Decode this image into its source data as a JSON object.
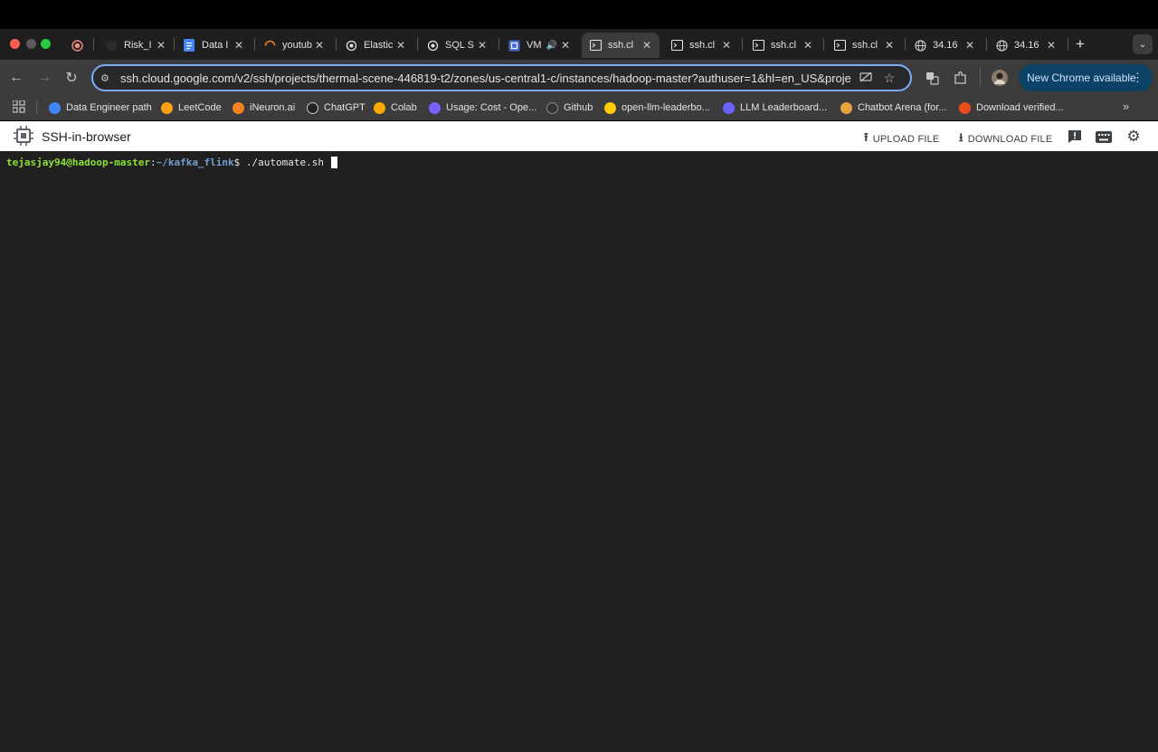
{
  "tabs": [
    {
      "label": "",
      "icon": "record-icon"
    },
    {
      "label": "Risk_I",
      "icon": "github-icon"
    },
    {
      "label": "Data I",
      "icon": "docs-icon"
    },
    {
      "label": "youtub",
      "icon": "loading-icon"
    },
    {
      "label": "Elastic",
      "icon": "openai-icon"
    },
    {
      "label": "SQL S",
      "icon": "openai-icon"
    },
    {
      "label": "VM",
      "icon": "compute-icon",
      "audio": true
    },
    {
      "label": "ssh.cl",
      "icon": "terminal-icon",
      "active": true
    },
    {
      "label": "ssh.cl",
      "icon": "terminal-icon"
    },
    {
      "label": "ssh.cl",
      "icon": "terminal-icon"
    },
    {
      "label": "ssh.cl",
      "icon": "terminal-icon"
    },
    {
      "label": "34.16",
      "icon": "globe-icon"
    },
    {
      "label": "34.16",
      "icon": "globe-icon"
    }
  ],
  "new_tab": "+",
  "address_bar": {
    "url": "ssh.cloud.google.com/v2/ssh/projects/thermal-scene-446819-t2/zones/us-central1-c/instances/hadoop-master?authuser=1&hl=en_US&projec..."
  },
  "update_pill": {
    "label": "New Chrome available",
    "color": "#0b4266"
  },
  "bookmarks": [
    {
      "label": "Data Engineer path",
      "color": "#4285f4"
    },
    {
      "label": "LeetCode",
      "color": "#ffa116"
    },
    {
      "label": "iNeuron.ai",
      "color": "#f6821f"
    },
    {
      "label": "ChatGPT",
      "color": "#222222"
    },
    {
      "label": "Colab",
      "color": "#f9ab00"
    },
    {
      "label": "Usage: Cost - Ope...",
      "color": "#7b61ff"
    },
    {
      "label": "Github",
      "color": "#333333"
    },
    {
      "label": "open-llm-leaderbo...",
      "color": "#ffcc00"
    },
    {
      "label": "LLM Leaderboard...",
      "color": "#6c63ff"
    },
    {
      "label": "Chatbot Arena (for...",
      "color": "#e8a33d"
    },
    {
      "label": "Download verified...",
      "color": "#e94e1b"
    }
  ],
  "app": {
    "title": "SSH-in-browser",
    "upload_label": "UPLOAD FILE",
    "download_label": "DOWNLOAD FILE"
  },
  "terminal": {
    "user_host": "tejasjay94@hadoop-master",
    "path": "~/kafka_flink",
    "command": "./automate.sh "
  }
}
